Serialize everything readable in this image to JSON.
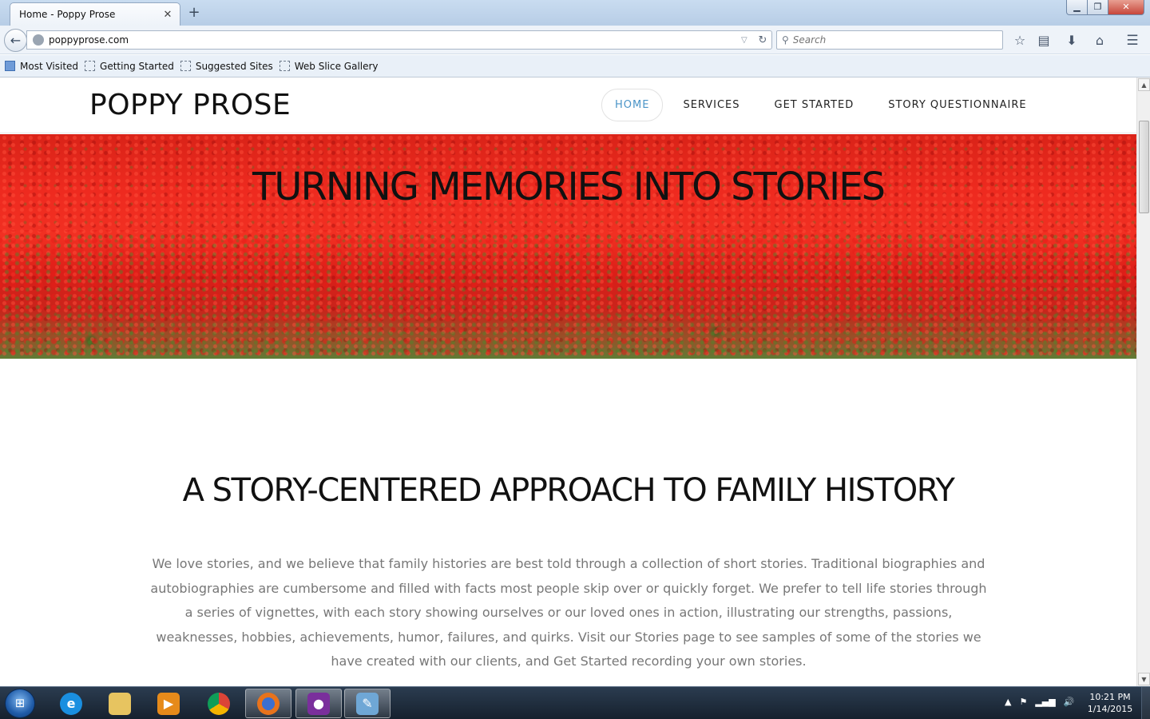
{
  "browser": {
    "tab_title": "Home - Poppy Prose",
    "tab_close": "✕",
    "new_tab": "+",
    "url": "poppyprose.com",
    "search_placeholder": "Search",
    "bookmarks": [
      "Most Visited",
      "Getting Started",
      "Suggested Sites",
      "Web Slice Gallery"
    ]
  },
  "site": {
    "logo": "POPPY PROSE",
    "nav": [
      "HOME",
      "SERVICES",
      "GET STARTED",
      "STORY QUESTIONNAIRE"
    ],
    "active_nav": "HOME",
    "active_color": "#4a94c7",
    "hero_title": "TURNING MEMORIES INTO STORIES",
    "section_title": "A STORY-CENTERED APPROACH TO FAMILY HISTORY",
    "section_body": "We love stories, and we believe that family histories are best told through a collection of short stories. Traditional biographies and autobiographies are cumbersome and filled with facts most people skip over or quickly forget. We prefer to tell life stories through a series of vignettes, with each story showing ourselves or our loved ones in action, illustrating our strengths, passions, weaknesses, hobbies, achievements, humor, failures, and quirks. Visit our Stories page to see samples of some of the stories we have created with our clients, and Get Started recording your own stories."
  },
  "taskbar": {
    "apps": [
      "internet-explorer",
      "windows-explorer",
      "media-player",
      "chrome",
      "firefox",
      "screen-recorder",
      "paint"
    ],
    "active_app": "firefox",
    "clock_time": "10:21 PM",
    "clock_date": "1/14/2015"
  }
}
